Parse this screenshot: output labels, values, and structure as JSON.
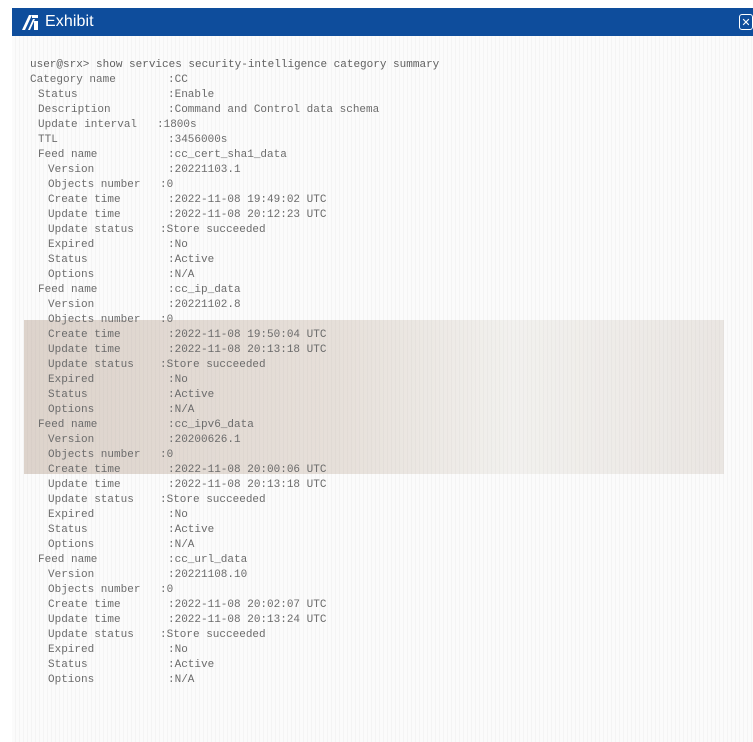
{
  "window": {
    "title": "Exhibit",
    "close_glyph": "✕",
    "title_icon": "exhibit-logo-icon",
    "title_bar_color": "#0e4d9c"
  },
  "terminal": {
    "prompt": "user@srx> show services security-intelligence category summary",
    "category": {
      "name_label": "Category name",
      "name_value": ":CC",
      "status_label": "Status",
      "status_value": ":Enable",
      "description_label": "Description",
      "description_value": ":Command and Control data schema",
      "update_interval_label": "Update interval",
      "update_interval_value": ":1800s",
      "ttl_label": "TTL",
      "ttl_value": ":3456000s"
    },
    "feeds": [
      {
        "name_label": "Feed name",
        "name_value": ":cc_cert_sha1_data",
        "version_label": "Version",
        "version_value": ":20221103.1",
        "objects_label": "Objects number",
        "objects_value": ":0",
        "create_label": "Create time",
        "create_value": ":2022-11-08 19:49:02 UTC",
        "update_label": "Update time",
        "update_value": ":2022-11-08 20:12:23 UTC",
        "update_status_label": "Update status",
        "update_status_value": ":Store succeeded",
        "expired_label": "Expired",
        "expired_value": ":No",
        "status_label": "Status",
        "status_value": ":Active",
        "options_label": "Options",
        "options_value": ":N/A"
      },
      {
        "name_label": "Feed name",
        "name_value": ":cc_ip_data",
        "version_label": "Version",
        "version_value": ":20221102.8",
        "objects_label": "Objects number",
        "objects_value": ":0",
        "create_label": "Create time",
        "create_value": ":2022-11-08 19:50:04 UTC",
        "update_label": "Update time",
        "update_value": ":2022-11-08 20:13:18 UTC",
        "update_status_label": "Update status",
        "update_status_value": ":Store succeeded",
        "expired_label": "Expired",
        "expired_value": ":No",
        "status_label": "Status",
        "status_value": ":Active",
        "options_label": "Options",
        "options_value": ":N/A"
      },
      {
        "name_label": "Feed name",
        "name_value": ":cc_ipv6_data",
        "version_label": "Version",
        "version_value": ":20200626.1",
        "objects_label": "Objects number",
        "objects_value": ":0",
        "create_label": "Create time",
        "create_value": ":2022-11-08 20:00:06 UTC",
        "update_label": "Update time",
        "update_value": ":2022-11-08 20:13:18 UTC",
        "update_status_label": "Update status",
        "update_status_value": ":Store succeeded",
        "expired_label": "Expired",
        "expired_value": ":No",
        "status_label": "Status",
        "status_value": ":Active",
        "options_label": "Options",
        "options_value": ":N/A"
      },
      {
        "name_label": "Feed name",
        "name_value": ":cc_url_data",
        "version_label": "Version",
        "version_value": ":20221108.10",
        "objects_label": "Objects number",
        "objects_value": ":0",
        "create_label": "Create time",
        "create_value": ":2022-11-08 20:02:07 UTC",
        "update_label": "Update time",
        "update_value": ":2022-11-08 20:13:24 UTC",
        "update_status_label": "Update status",
        "update_status_value": ":Store succeeded",
        "expired_label": "Expired",
        "expired_value": ":No",
        "status_label": "Status",
        "status_value": ":Active",
        "options_label": "Options",
        "options_value": ":N/A"
      }
    ]
  }
}
